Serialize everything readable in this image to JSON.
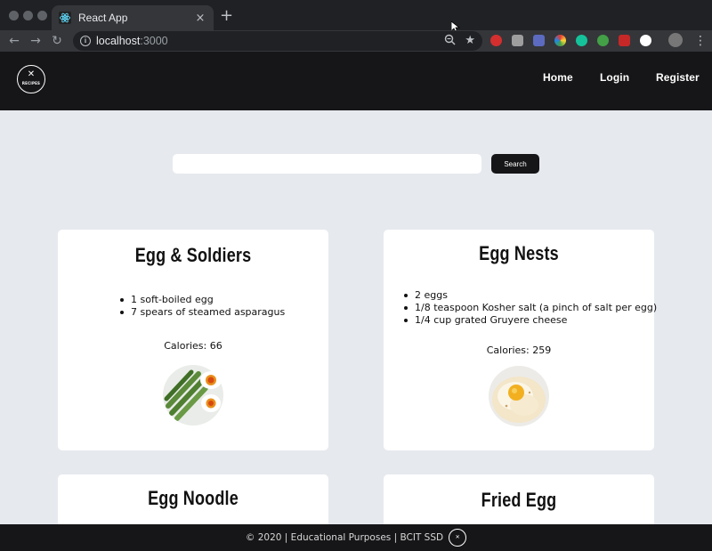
{
  "browser": {
    "tab_title": "React App",
    "tab_close": "×",
    "new_tab": "+",
    "url_host": "localhost",
    "url_port": ":3000",
    "icons": [
      "react-favicon-icon",
      "zoom-icon",
      "bookmark-star-icon",
      "kebab-menu-icon"
    ]
  },
  "header": {
    "logo_text": "RECIPES",
    "logo_glyph": "✕",
    "nav": [
      "Home",
      "Login",
      "Register"
    ]
  },
  "search": {
    "value": "",
    "button_label": "Search"
  },
  "recipes": [
    {
      "title": "Egg & Soldiers",
      "ingredients": [
        "1 soft-boiled egg",
        "7 spears of steamed asparagus"
      ],
      "calories": "Calories: 66"
    },
    {
      "title": "Egg Nests",
      "ingredients": [
        "2 eggs",
        "1/8 teaspoon Kosher salt (a pinch of salt per egg)",
        "1/4 cup grated Gruyere cheese"
      ],
      "calories": "Calories: 259"
    },
    {
      "title": "Egg Noodle"
    },
    {
      "title": "Fried Egg"
    }
  ],
  "footer": {
    "text": "© 2020 | Educational Purposes | BCIT SSD",
    "logo_text": "RECIPES"
  },
  "colors": {
    "page_bg": "#e6e9ee",
    "header_bg": "#161618",
    "card_bg": "#ffffff"
  }
}
